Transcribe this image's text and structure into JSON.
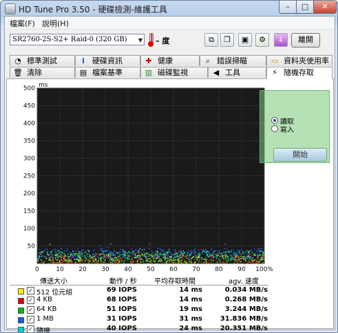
{
  "window": {
    "title": "HD Tune Pro 3.50 - 硬碟檢測-維護工具",
    "min": "–",
    "max": "□",
    "close": "✕"
  },
  "menu": {
    "file": "檔案(F)",
    "help": "說明(H)"
  },
  "toolbar": {
    "drive": "SR2760-2S-S2+ Raid-0 (320 GB)",
    "temperature": "– 度",
    "exit": "離開"
  },
  "tabs_row1": [
    {
      "label": "標準測試",
      "icon": "gauge-icon"
    },
    {
      "label": "硬碟資訊",
      "icon": "info-icon"
    },
    {
      "label": "健康",
      "icon": "health-cross-icon"
    },
    {
      "label": "錯誤掃瞄",
      "icon": "magnifier-icon"
    },
    {
      "label": "資料夾使用率",
      "icon": "folder-icon"
    }
  ],
  "tabs_row2": [
    {
      "label": "清除",
      "icon": "trash-icon"
    },
    {
      "label": "檔案基準",
      "icon": "file-benchmark-icon"
    },
    {
      "label": "磁碟監視",
      "icon": "monitor-icon"
    },
    {
      "label": "工具",
      "icon": "speaker-icon"
    },
    {
      "label": "隨機存取",
      "icon": "random-access-icon"
    }
  ],
  "controls": {
    "start": "開始",
    "read": "讀取",
    "write": "寫入",
    "read_selected": true
  },
  "chart_data": {
    "type": "scatter",
    "ylabel": "ms",
    "ylim": [
      0,
      500
    ],
    "y_ticks": [
      "500",
      "450",
      "400",
      "350",
      "300",
      "250",
      "200",
      "150",
      "100",
      "50"
    ],
    "x_ticks": [
      "0",
      "10",
      "20",
      "30",
      "40",
      "50",
      "60",
      "70",
      "80",
      "90",
      "100%"
    ],
    "xlim": [
      0,
      100
    ],
    "background": "#1a1a1a",
    "grid": true,
    "series": [
      {
        "name": "512 位元組",
        "color": "#ffff00",
        "center_ms": 14
      },
      {
        "name": "4 KB",
        "color": "#ff2a2a",
        "center_ms": 14
      },
      {
        "name": "64 KB",
        "color": "#22cc22",
        "center_ms": 19
      },
      {
        "name": "1 MB",
        "color": "#2266ff",
        "center_ms": 31
      },
      {
        "name": "隨機",
        "color": "#22dddd",
        "center_ms": 24
      }
    ]
  },
  "table": {
    "headers": [
      "傳送大小",
      "動作 / 秒",
      "平均存取時間",
      "agv. 速度"
    ],
    "rows": [
      {
        "color": "#ffee00",
        "checked": "✓",
        "name": "512 位元組",
        "iops": "69 IOPS",
        "access": "14 ms",
        "speed": "0.034 MB/s"
      },
      {
        "color": "#dd0000",
        "checked": "✓",
        "name": "4 KB",
        "iops": "68 IOPS",
        "access": "14 ms",
        "speed": "0.268 MB/s"
      },
      {
        "color": "#00bb00",
        "checked": "✓",
        "name": "64 KB",
        "iops": "51 IOPS",
        "access": "19 ms",
        "speed": "3.244 MB/s"
      },
      {
        "color": "#1155ff",
        "checked": "✓",
        "name": "1 MB",
        "iops": "31 IOPS",
        "access": "31 ms",
        "speed": "31.836 MB/s"
      },
      {
        "color": "#00d0d0",
        "checked": "✓",
        "name": "隨機",
        "iops": "40 IOPS",
        "access": "24 ms",
        "speed": "20.351 MB/s"
      }
    ]
  }
}
